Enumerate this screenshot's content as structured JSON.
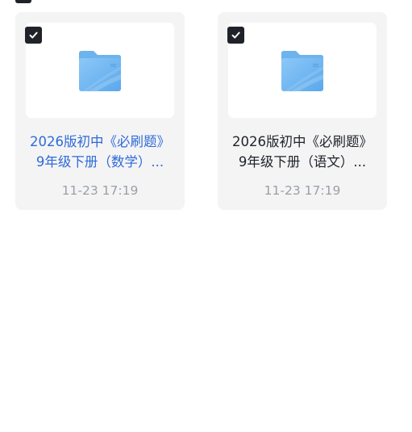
{
  "files": [
    {
      "title_line1": "2026版初中《必刷题》",
      "title_line2": "9年级下册（数学）...",
      "time": "11-23 17:19",
      "selected": true,
      "highlighted": true,
      "icon": "folder-icon"
    },
    {
      "title_line1": "2026版初中《必刷题》",
      "title_line2": "9年级下册（语文）...",
      "time": "11-23 17:19",
      "selected": true,
      "highlighted": false,
      "icon": "folder-icon"
    }
  ],
  "colors": {
    "accent": "#2f6bd8",
    "text": "#1f2329",
    "muted": "#9aa0a6",
    "card_bg": "#f4f4f5",
    "checkbox_bg": "#1f2329"
  }
}
